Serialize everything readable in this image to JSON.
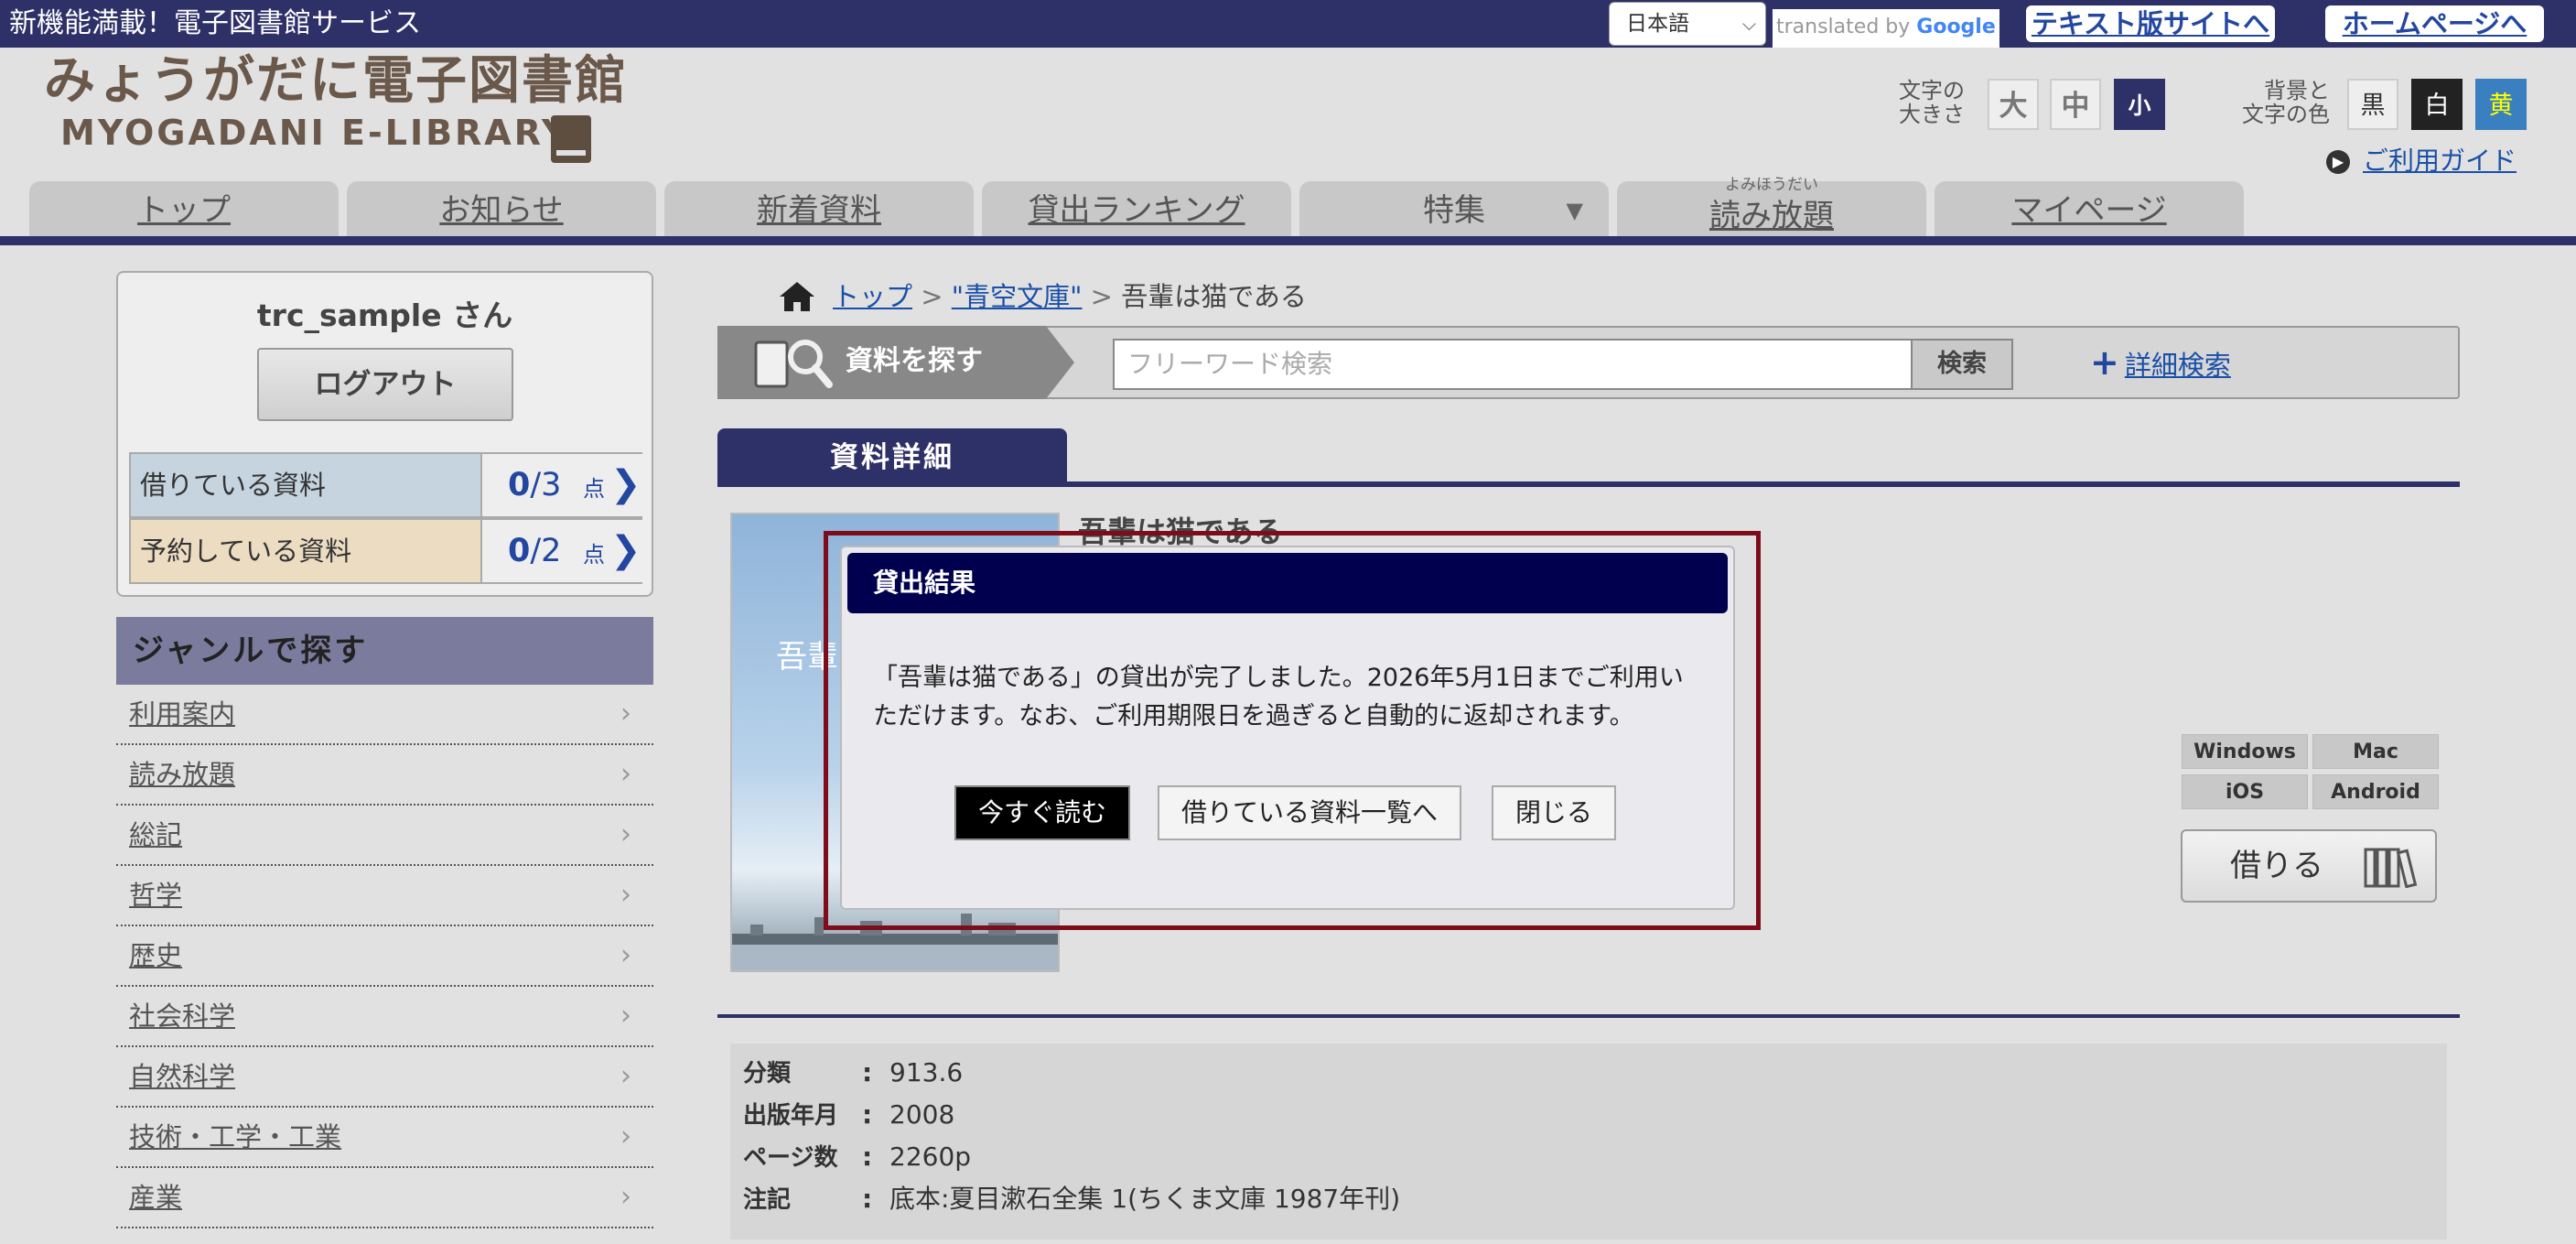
{
  "topbar": {
    "banner": "新機能満載！電子図書館サービス",
    "language": "日本語",
    "translated_by": "translated by",
    "google": "Google",
    "text_site_link": "テキスト版サイトへ",
    "home_link": "ホームページへ"
  },
  "header": {
    "logo_jp": "みょうがだに電子図書館",
    "logo_en": "MYOGADANI E-LIBRARY",
    "font_size_label_1": "文字の",
    "font_size_label_2": "大きさ",
    "font_large": "大",
    "font_medium": "中",
    "font_small": "小",
    "bg_label_1": "背景と",
    "bg_label_2": "文字の色",
    "bg_black": "黒",
    "bg_white": "白",
    "bg_yellow": "黄",
    "guide": "ご利用ガイド"
  },
  "nav": {
    "top": "トップ",
    "news": "お知らせ",
    "new_items": "新着資料",
    "ranking": "貸出ランキング",
    "feature": "特集",
    "unlimited_ruby": "よみほうだい",
    "unlimited": "読み放題",
    "mypage": "マイページ"
  },
  "sidebar": {
    "user_name": "trc_sample さん",
    "logout": "ログアウト",
    "borrowed_label": "借りている資料",
    "borrowed_count": "0",
    "borrowed_max": "/3",
    "reserved_label": "予約している資料",
    "reserved_count": "0",
    "reserved_max": "/2",
    "unit": "点",
    "genre_heading": "ジャンルで探す",
    "genres": [
      "利用案内",
      "読み放題",
      "総記",
      "哲学",
      "歴史",
      "社会科学",
      "自然科学",
      "技術・工学・工業",
      "産業"
    ]
  },
  "breadcrumb": {
    "top": "トップ",
    "sep": ">",
    "collection": "\"青空文庫\"",
    "current": "吾輩は猫である"
  },
  "search": {
    "label": "資料を探す",
    "placeholder": "フリーワード検索",
    "button": "検索",
    "advanced": "詳細検索"
  },
  "detail": {
    "tab": "資料詳細",
    "book_title": "吾輩は猫である",
    "cover_text": "吾輩",
    "platforms": [
      "Windows",
      "Mac",
      "iOS",
      "Android"
    ],
    "borrow_button": "借りる",
    "info": [
      {
        "key": "分類",
        "value": "913.6"
      },
      {
        "key": "出版年月",
        "value": "2008"
      },
      {
        "key": "ページ数",
        "value": "2260p"
      },
      {
        "key": "注記",
        "value": "底本:夏目漱石全集 1(ちくま文庫 1987年刊)"
      }
    ]
  },
  "modal": {
    "title": "貸出結果",
    "message": "「吾輩は猫である」の貸出が完了しました。2026年5月1日までご利用いただけます。なお、ご利用期限日を過ぎると自動的に返却されます。",
    "read_now": "今すぐ読む",
    "borrowed_list": "借りている資料一覧へ",
    "close": "閉じる"
  }
}
